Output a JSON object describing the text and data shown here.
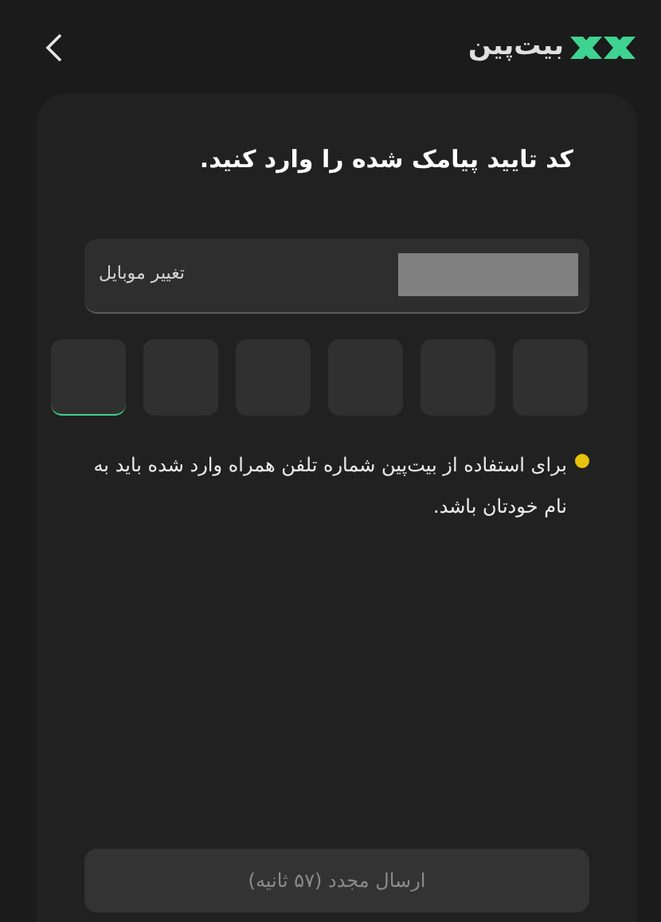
{
  "header": {
    "logo_text": "بیت‌پین"
  },
  "card": {
    "title": "کد تایید پیامک شده را وارد کنید.",
    "phone": {
      "change_link": "تغییر موبایل"
    },
    "otp_boxes": [
      {
        "focused": true
      },
      {
        "focused": false
      },
      {
        "focused": false
      },
      {
        "focused": false
      },
      {
        "focused": false
      },
      {
        "focused": false
      }
    ],
    "note": {
      "text": "برای استفاده از بیت‌پین شماره تلفن همراه وارد شده باید به نام خودتان باشد.",
      "color": "#e8c20f"
    },
    "resend_button": {
      "label": "ارسال مجدد (۵۷ ثانیه)",
      "disabled": true
    }
  }
}
